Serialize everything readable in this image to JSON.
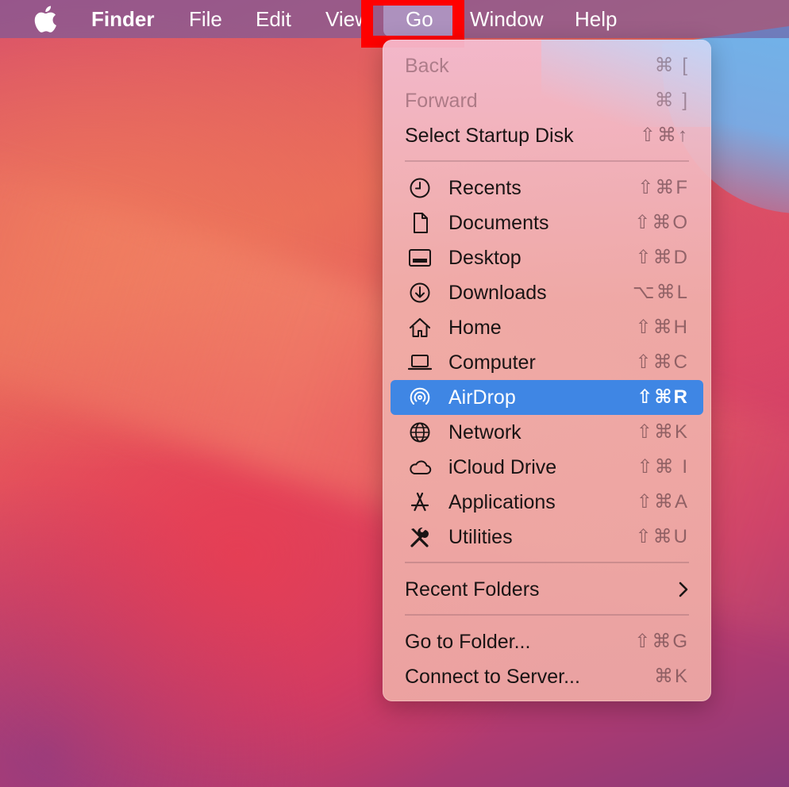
{
  "menubar": {
    "apple_icon": "apple-logo-icon",
    "items": [
      {
        "label": "Finder",
        "bold": true
      },
      {
        "label": "File"
      },
      {
        "label": "Edit"
      },
      {
        "label": "View"
      },
      {
        "label": "Go",
        "active": true
      },
      {
        "label": "Window"
      },
      {
        "label": "Help"
      }
    ]
  },
  "go_menu": {
    "items": [
      {
        "label": "Back",
        "shortcut": "⌘ [",
        "disabled": true
      },
      {
        "label": "Forward",
        "shortcut": "⌘ ]",
        "disabled": true
      },
      {
        "label": "Select Startup Disk",
        "shortcut": "⇧⌘↑"
      },
      {
        "label": "Recents",
        "shortcut": "⇧⌘F",
        "icon": "clock-icon"
      },
      {
        "label": "Documents",
        "shortcut": "⇧⌘O",
        "icon": "document-icon"
      },
      {
        "label": "Desktop",
        "shortcut": "⇧⌘D",
        "icon": "desktop-icon"
      },
      {
        "label": "Downloads",
        "shortcut": "⌥⌘L",
        "icon": "download-icon"
      },
      {
        "label": "Home",
        "shortcut": "⇧⌘H",
        "icon": "home-icon"
      },
      {
        "label": "Computer",
        "shortcut": "⇧⌘C",
        "icon": "laptop-icon"
      },
      {
        "label": "AirDrop",
        "shortcut": "⇧⌘R",
        "icon": "airdrop-icon",
        "selected": true
      },
      {
        "label": "Network",
        "shortcut": "⇧⌘K",
        "icon": "globe-icon"
      },
      {
        "label": "iCloud Drive",
        "shortcut": "⇧⌘ I",
        "icon": "cloud-icon"
      },
      {
        "label": "Applications",
        "shortcut": "⇧⌘A",
        "icon": "applications-icon"
      },
      {
        "label": "Utilities",
        "shortcut": "⇧⌘U",
        "icon": "utilities-icon"
      },
      {
        "label": "Recent Folders",
        "submenu": true,
        "icon": "chevron-right-icon"
      },
      {
        "label": "Go to Folder...",
        "shortcut": "⇧⌘G"
      },
      {
        "label": "Connect to Server...",
        "shortcut": "⌘K"
      }
    ]
  },
  "colors": {
    "selection": "#3f86e4",
    "annotation_box": "#ff0000"
  }
}
